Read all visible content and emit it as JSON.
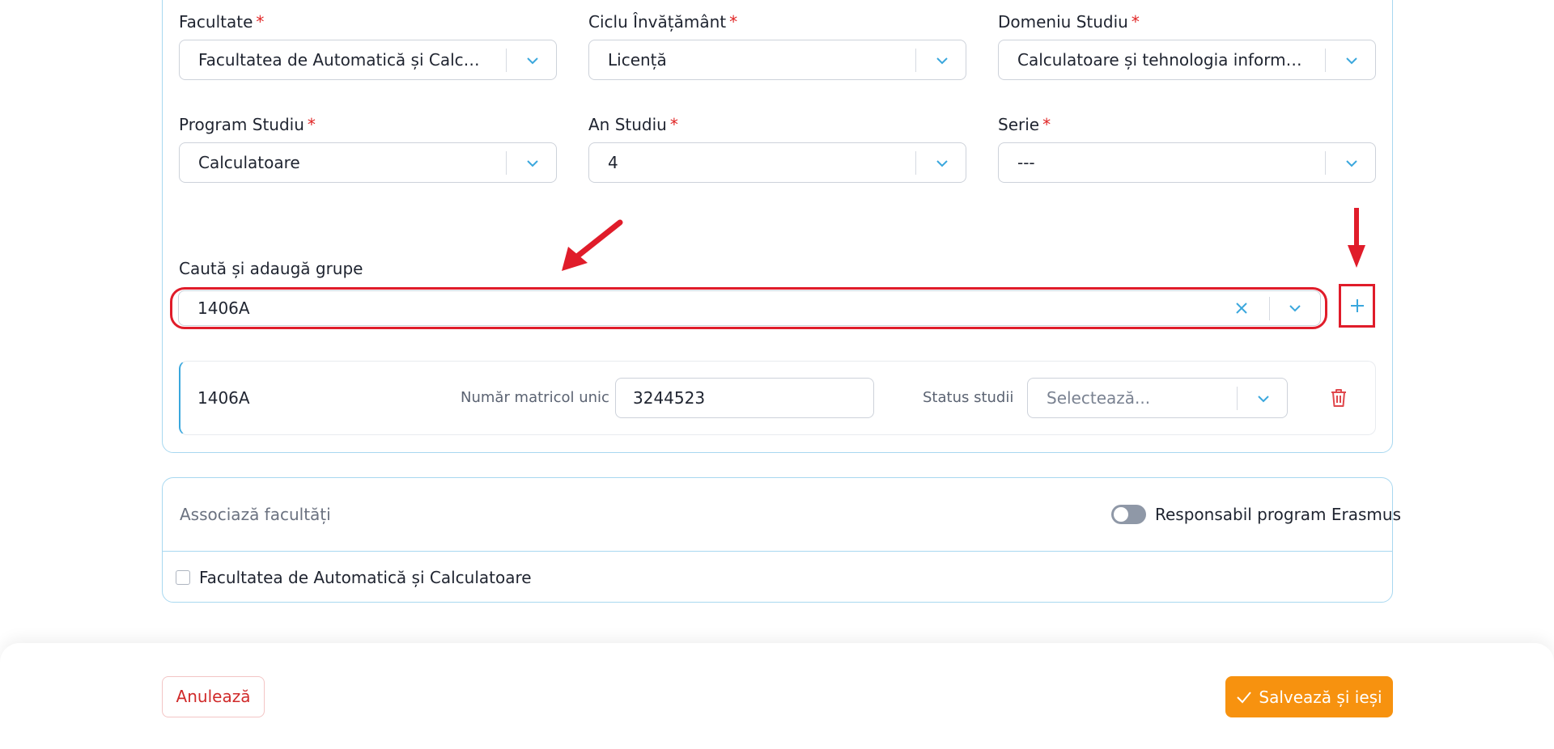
{
  "colors": {
    "accent_blue": "#3aa7dd",
    "required_red": "#e02424",
    "annotation_red": "#e01c2a",
    "save_orange": "#f7920f",
    "card_border": "#a8d8f0"
  },
  "form": {
    "required_mark": "*",
    "fields": {
      "facultate": {
        "label": "Facultate",
        "value": "Facultatea de Automatică și Calculato..."
      },
      "ciclu": {
        "label": "Ciclu Învățământ",
        "value": "Licență"
      },
      "domeniu": {
        "label": "Domeniu Studiu",
        "value": "Calculatoare și tehnologia informației"
      },
      "program": {
        "label": "Program Studiu",
        "value": "Calculatoare"
      },
      "an": {
        "label": "An Studiu",
        "value": "4"
      },
      "serie": {
        "label": "Serie",
        "value": "---"
      }
    },
    "group_search": {
      "label": "Caută și adaugă grupe",
      "value": "1406A",
      "clear_icon": "close-icon",
      "dropdown_icon": "chevron-down-icon",
      "add_icon": "plus-icon"
    },
    "group_row": {
      "name": "1406A",
      "matricol_label": "Număr matricol unic",
      "matricol_value": "3244523",
      "status_label": "Status studii",
      "status_placeholder": "Selectează...",
      "delete_icon": "trash-icon"
    }
  },
  "associations": {
    "title": "Associază facultăți",
    "toggle_label": "Responsabil program Erasmus",
    "toggle_on": false,
    "faculties": [
      {
        "label": "Facultatea de Automatică și Calculatoare",
        "checked": false
      }
    ]
  },
  "footer": {
    "cancel_label": "Anulează",
    "save_label": "Salvează și ieși",
    "save_icon": "check-icon"
  },
  "annotations": [
    "arrow-diagonal",
    "arrow-down"
  ]
}
